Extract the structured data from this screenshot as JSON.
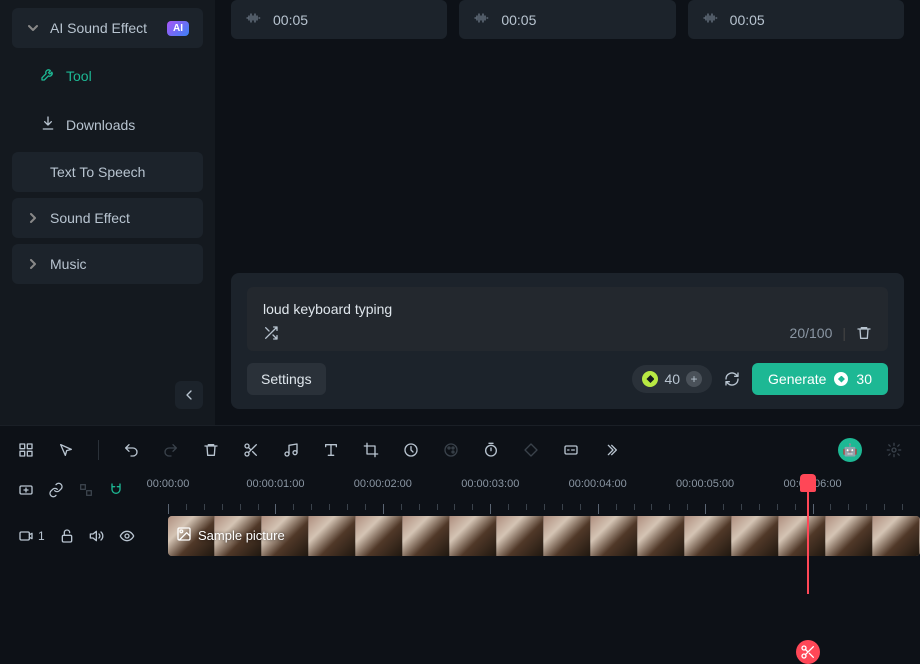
{
  "sidebar": {
    "items": [
      {
        "label": "AI Sound Effect",
        "badge": "AI",
        "expanded": true
      },
      {
        "label": "Tool",
        "active": true,
        "indent": true
      },
      {
        "label": "Downloads",
        "indent": true
      },
      {
        "label": "Text To Speech"
      },
      {
        "label": "Sound Effect",
        "expandable": true
      },
      {
        "label": "Music",
        "expandable": true
      }
    ]
  },
  "clips": [
    {
      "duration": "00:05"
    },
    {
      "duration": "00:05"
    },
    {
      "duration": "00:05"
    }
  ],
  "prompt": {
    "text": "loud keyboard typing",
    "char_count": "20/100"
  },
  "controls": {
    "settings": "Settings",
    "credits": "40",
    "generate": "Generate",
    "gen_cost": "30"
  },
  "timeline": {
    "marks": [
      "00:00:00",
      "00:00:01:00",
      "00:00:02:00",
      "00:00:03:00",
      "00:00:04:00",
      "00:00:05:00",
      "00:00:06:00"
    ],
    "playhead_pct": 85,
    "track_number": "1",
    "clip_label": "Sample picture"
  }
}
